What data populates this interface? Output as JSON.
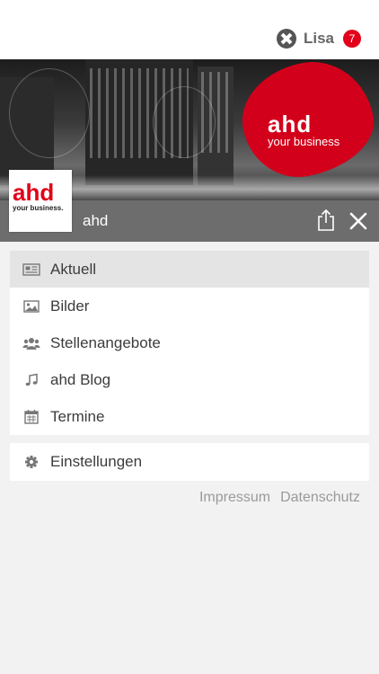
{
  "header": {
    "user_name": "Lisa",
    "notification_count": "7"
  },
  "banner": {
    "brand_name": "ahd",
    "brand_tagline": "your business"
  },
  "bar": {
    "title": "ahd"
  },
  "logo": {
    "name": "ahd",
    "tagline": "your business."
  },
  "menu": {
    "items": [
      {
        "label": "Aktuell",
        "icon": "newspaper-icon",
        "active": true
      },
      {
        "label": "Bilder",
        "icon": "image-icon",
        "active": false
      },
      {
        "label": "Stellenangebote",
        "icon": "users-icon",
        "active": false
      },
      {
        "label": "ahd Blog",
        "icon": "music-note-icon",
        "active": false
      },
      {
        "label": "Termine",
        "icon": "calendar-icon",
        "active": false
      }
    ],
    "settings_label": "Einstellungen"
  },
  "footer": {
    "impressum": "Impressum",
    "datenschutz": "Datenschutz"
  },
  "colors": {
    "accent_red": "#e2001a",
    "bar_gray": "#6d6d6d",
    "active_item_bg": "#e4e4e4"
  }
}
